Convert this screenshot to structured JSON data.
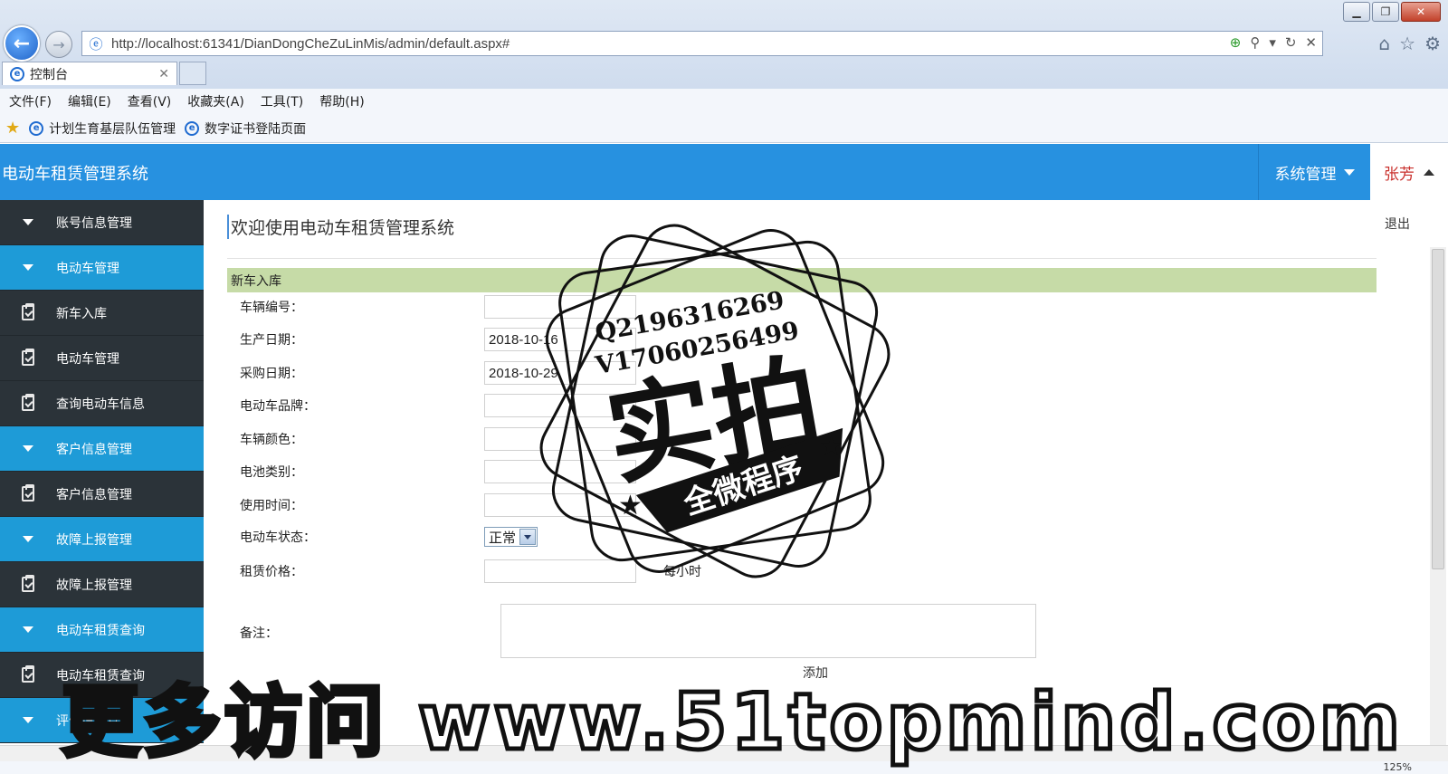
{
  "browser": {
    "url": "http://localhost:61341/DianDongCheZuLinMis/admin/default.aspx#",
    "tab_title": "控制台",
    "menu": [
      "文件(F)",
      "编辑(E)",
      "查看(V)",
      "收藏夹(A)",
      "工具(T)",
      "帮助(H)"
    ],
    "favorites": [
      "计划生育基层队伍管理",
      "数字证书登陆页面"
    ],
    "zoom": "125%"
  },
  "header": {
    "app_title": "电动车租赁管理系统",
    "system_menu": "系统管理",
    "user_name": "张芳"
  },
  "sidebar": {
    "items": [
      {
        "label": "账号信息管理",
        "type": "group"
      },
      {
        "label": "电动车管理",
        "type": "group-active"
      },
      {
        "label": "新车入库",
        "type": "leaf"
      },
      {
        "label": "电动车管理",
        "type": "leaf"
      },
      {
        "label": "查询电动车信息",
        "type": "leaf"
      },
      {
        "label": "客户信息管理",
        "type": "group-active"
      },
      {
        "label": "客户信息管理",
        "type": "leaf"
      },
      {
        "label": "故障上报管理",
        "type": "group-active"
      },
      {
        "label": "故障上报管理",
        "type": "leaf"
      },
      {
        "label": "电动车租赁查询",
        "type": "group-active"
      },
      {
        "label": "电动车租赁查询",
        "type": "leaf"
      },
      {
        "label": "评价信息管理",
        "type": "group-active"
      }
    ]
  },
  "main": {
    "welcome": "欢迎使用电动车租赁管理系统",
    "logout": "退出",
    "panel_title": "新车入库",
    "fields": {
      "vehicle_no": {
        "label": "车辆编号：",
        "value": ""
      },
      "production_date": {
        "label": "生产日期：",
        "value": "2018-10-16"
      },
      "purchase_date": {
        "label": "采购日期：",
        "value": "2018-10-29"
      },
      "brand": {
        "label": "电动车品牌：",
        "value": ""
      },
      "color": {
        "label": "车辆颜色：",
        "value": ""
      },
      "battery": {
        "label": "电池类别：",
        "value": ""
      },
      "usage_time": {
        "label": "使用时间：",
        "value": ""
      },
      "status": {
        "label": "电动车状态：",
        "value": "正常"
      },
      "price": {
        "label": "租赁价格：",
        "value": "",
        "unit": "每小时"
      },
      "remark": {
        "label": "备注：",
        "value": ""
      }
    },
    "add_button": "添加"
  },
  "watermark": {
    "contact_q": "Q2196316269",
    "contact_v": "V17060256499",
    "stamp_main": "实拍",
    "stamp_sub": "全微程序",
    "banner": "更多访问 www.51topmind.com"
  },
  "colors": {
    "header_bg": "#2791e0",
    "sidebar_group": "#1e9bd7",
    "sidebar_leaf": "#2b3339",
    "panel_head": "#c6dba7",
    "user_name": "#c9302c"
  }
}
